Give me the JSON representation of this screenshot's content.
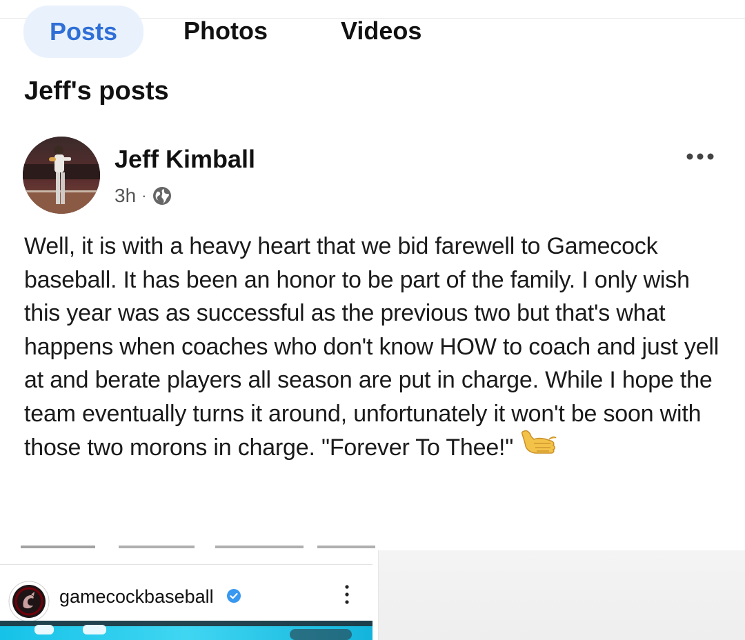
{
  "tabs": [
    {
      "label": "Posts",
      "active": true
    },
    {
      "label": "Photos",
      "active": false
    },
    {
      "label": "Videos",
      "active": false
    }
  ],
  "section_title": "Jeff's posts",
  "post": {
    "author": "Jeff Kimball",
    "time": "3h",
    "separator": "·",
    "audience_icon": "globe-icon",
    "menu_icon": "more-horizontal-icon",
    "body": "Well, it is with a heavy heart that we bid farewell to Gamecock baseball. It has been an honor to be part of the family. I only wish this year was as successful as the previous two but that's what happens when coaches who don't know HOW to coach and just yell at and berate players all season are put in charge. While I hope the team eventually turns it around, unfortunately it won't be soon with those two morons in charge. \"Forever To Thee!\"",
    "emoji": "call-me-hand-icon"
  },
  "embed": {
    "username": "gamecockbaseball",
    "verified": true,
    "menu_icon": "kebab-vertical-icon"
  },
  "colors": {
    "active_tab_bg": "#e9f2fc",
    "active_tab_text": "#2f6fd6",
    "text": "#111111",
    "meta": "#555555",
    "verified": "#3897f0"
  }
}
